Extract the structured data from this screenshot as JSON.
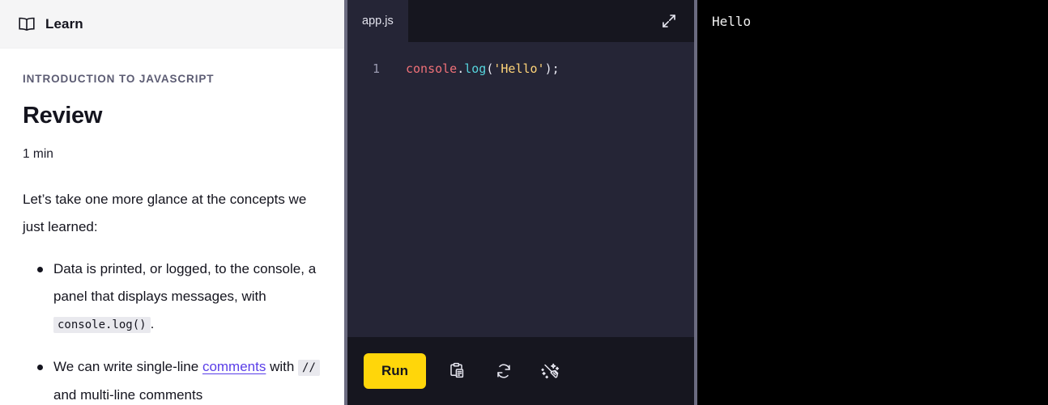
{
  "learn": {
    "header": {
      "icon": "book-open-icon",
      "title": "Learn"
    },
    "eyebrow": "INTRODUCTION TO JAVASCRIPT",
    "lesson_title": "Review",
    "duration": "1 min",
    "intro_paragraph": "Let’s take one more glance at the concepts we just learned:",
    "bullets": [
      {
        "part1": "Data is printed, or logged, to the console, a panel that displays messages, with ",
        "code1": "console.log()",
        "part2": ".",
        "link": null,
        "code2": null,
        "part3": null
      },
      {
        "part1": "We can write single-line ",
        "link": "comments",
        "part2": " with ",
        "code1": "//",
        "part3": " and multi-line comments"
      }
    ]
  },
  "editor": {
    "tab": {
      "label": "app.js",
      "active": true
    },
    "expand_icon": "expand-diagonal-icon",
    "lines": [
      {
        "number": "1",
        "tokens": [
          {
            "text": "console",
            "type": "obj"
          },
          {
            "text": ".",
            "type": "punc"
          },
          {
            "text": "log",
            "type": "fn"
          },
          {
            "text": "(",
            "type": "punc"
          },
          {
            "text": "'Hello'",
            "type": "str"
          },
          {
            "text": ");",
            "type": "punc"
          }
        ]
      }
    ],
    "toolbar": {
      "run_label": "Run",
      "icons": [
        {
          "name": "copy-clipboard-icon",
          "title": "Copy to clipboard"
        },
        {
          "name": "reset-refresh-icon",
          "title": "Reset code"
        },
        {
          "name": "format-broom-icon",
          "title": "Format code"
        }
      ]
    }
  },
  "console": {
    "lines": [
      "Hello"
    ]
  },
  "colors": {
    "accent_run": "#ffd60a",
    "link": "#5a3ee8",
    "editor_bg": "#252536",
    "toolbar_bg": "#16161f",
    "console_bg": "#000000",
    "divider": "#6b6b80"
  }
}
